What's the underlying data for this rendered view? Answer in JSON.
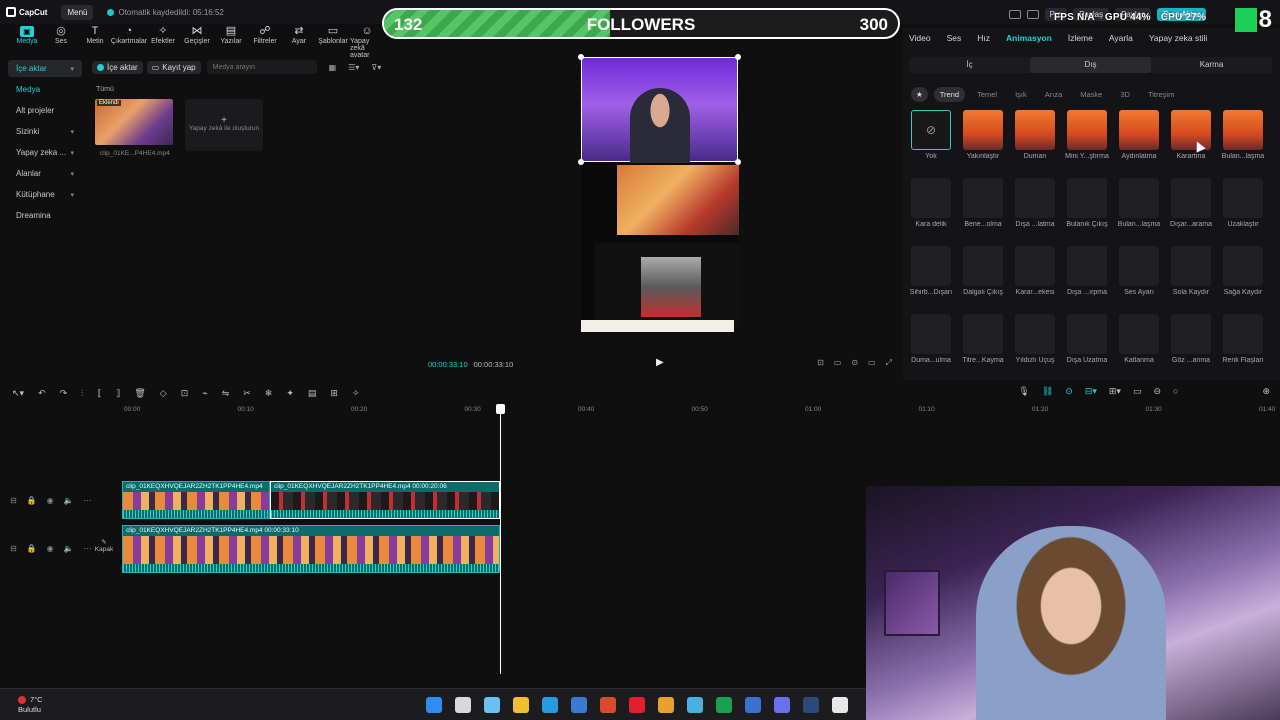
{
  "app": {
    "menu_label": "Menü",
    "autosave_text": "Otomatik kaydedildi: 05:16:52"
  },
  "overlay": {
    "followers_current": "132",
    "followers_title": "FOLLOWERS",
    "followers_target": "300",
    "followers_progress": 0.44,
    "fps_label": "FPS N/A",
    "gpu_label": "GPU 44%",
    "cpu_label": "CPU 27%",
    "channel_badge": "8"
  },
  "top_right": {
    "pro_label": "Pro",
    "share1": "Paylaş",
    "share2": "Paylaş",
    "export": "Dışa Aktar"
  },
  "tools": [
    {
      "label": "Medya",
      "icon": "▣",
      "active": true
    },
    {
      "label": "Ses",
      "icon": "◎"
    },
    {
      "label": "Metin",
      "icon": "T"
    },
    {
      "label": "Çıkartmalar",
      "icon": "◔"
    },
    {
      "label": "Efektler",
      "icon": "✧"
    },
    {
      "label": "Geçişler",
      "icon": "⋈"
    },
    {
      "label": "Yazılar",
      "icon": "▤"
    },
    {
      "label": "Filtreler",
      "icon": "☍"
    },
    {
      "label": "Ayar",
      "icon": "⇄"
    },
    {
      "label": "Şablonlar",
      "icon": "▭"
    },
    {
      "label": "Yapay zekâ avatar",
      "icon": "☺"
    }
  ],
  "left_nav": [
    {
      "label": "İçe aktar",
      "chevron": "▾",
      "state": "active"
    },
    {
      "label": "Medya",
      "chevron": "",
      "state": "sel"
    },
    {
      "label": "Alt projeler",
      "chevron": "",
      "state": ""
    },
    {
      "label": "Sizinki",
      "chevron": "▾",
      "state": ""
    },
    {
      "label": "Yapay zeka ...",
      "chevron": "▾",
      "state": ""
    },
    {
      "label": "Alanlar",
      "chevron": "▾",
      "state": ""
    },
    {
      "label": "Kütüphane",
      "chevron": "▾",
      "state": ""
    },
    {
      "label": "Dreamina",
      "chevron": "",
      "state": ""
    }
  ],
  "media": {
    "import_btn": "İçe aktar",
    "record_btn": "Kayıt yap",
    "search_placeholder": "Medya arayın",
    "all_label": "Tümü",
    "added_badge": "Eklendi",
    "file_name": "clip_01KE...P4HE4.mp4",
    "ai_tile_label": "Yapay zekâ ile oluşturun"
  },
  "preview": {
    "time_current": "00:00:33:10",
    "time_total": "00:00:33:10"
  },
  "right_panel": {
    "tabs": [
      {
        "label": "Video"
      },
      {
        "label": "Ses"
      },
      {
        "label": "Hız"
      },
      {
        "label": "Animasyon",
        "active": true
      },
      {
        "label": "İzleme"
      },
      {
        "label": "Ayarla"
      },
      {
        "label": "Yapay zeka stili"
      }
    ],
    "segments": [
      {
        "label": "İç"
      },
      {
        "label": "Dış",
        "on": true
      },
      {
        "label": "Karma"
      }
    ],
    "chips": [
      {
        "label": "Trend",
        "on": true
      },
      {
        "label": "Temel"
      },
      {
        "label": "Işık"
      },
      {
        "label": "Arıza"
      },
      {
        "label": "Maske"
      },
      {
        "label": "3D"
      },
      {
        "label": "Titreşim"
      }
    ],
    "animations": [
      {
        "label": "Yok",
        "kind": "none"
      },
      {
        "label": "Yakınlaştır",
        "kind": "img"
      },
      {
        "label": "Duman",
        "kind": "img"
      },
      {
        "label": "Mini Y...ştırma",
        "kind": "img"
      },
      {
        "label": "Aydınlatma",
        "kind": "img"
      },
      {
        "label": "Karartma",
        "kind": "img"
      },
      {
        "label": "Bulan...laşma",
        "kind": "img"
      },
      {
        "label": "Kara delik",
        "kind": "blank"
      },
      {
        "label": "Bene...olma",
        "kind": "blank"
      },
      {
        "label": "Dışa ...latma",
        "kind": "blank"
      },
      {
        "label": "Bulanık Çıkış",
        "kind": "blank"
      },
      {
        "label": "Bulan...laşma",
        "kind": "blank"
      },
      {
        "label": "Dışar...arama",
        "kind": "blank"
      },
      {
        "label": "Uzaklaştır",
        "kind": "blank"
      },
      {
        "label": "Sihirb...Dışarı",
        "kind": "blank"
      },
      {
        "label": "Dalgalı Çıkış",
        "kind": "blank"
      },
      {
        "label": "Karar...ekesi",
        "kind": "blank"
      },
      {
        "label": "Dışa ...ırpma",
        "kind": "blank"
      },
      {
        "label": "Ses Ayarı",
        "kind": "blank"
      },
      {
        "label": "Sola Kaydır",
        "kind": "blank"
      },
      {
        "label": "Sağa Kaydır",
        "kind": "blank"
      },
      {
        "label": "Duma...ulma",
        "kind": "blank"
      },
      {
        "label": "Titre...Kayma",
        "kind": "blank"
      },
      {
        "label": "Yıldızlı Uçuş",
        "kind": "blank"
      },
      {
        "label": "Dışa Uzatma",
        "kind": "blank"
      },
      {
        "label": "Katlanma",
        "kind": "blank"
      },
      {
        "label": "Göz ...anma",
        "kind": "blank"
      },
      {
        "label": "Renk Flaşları",
        "kind": "blank"
      }
    ]
  },
  "timeline": {
    "ruler": [
      "00:00",
      "00:10",
      "00:20",
      "00:30",
      "00:40",
      "00:50",
      "01:00",
      "01:10",
      "01:20",
      "01:30",
      "01:40"
    ],
    "clip_a_label": "clip_01KEQXHVQEJAR2ZH2TK1PP4HE4.mp4",
    "clip_b_label": "clip_01KEQXHVQEJAR2ZH2TK1PP4HE4.mp4  00:00:20:06",
    "clip_c_label": "clip_01KEQXHVQEJAR2ZH2TK1PP4HE4.mp4  00:00:33:10",
    "cover_label": "Kapak"
  },
  "taskbar": {
    "temperature": "7°C",
    "weather": "Bulutlu",
    "apps": [
      "windows-start",
      "file-explorer",
      "copilot",
      "folder",
      "edge",
      "mail",
      "office",
      "opera",
      "chrome",
      "snipping",
      "xbox",
      "store",
      "discord",
      "steam",
      "capcut"
    ]
  }
}
